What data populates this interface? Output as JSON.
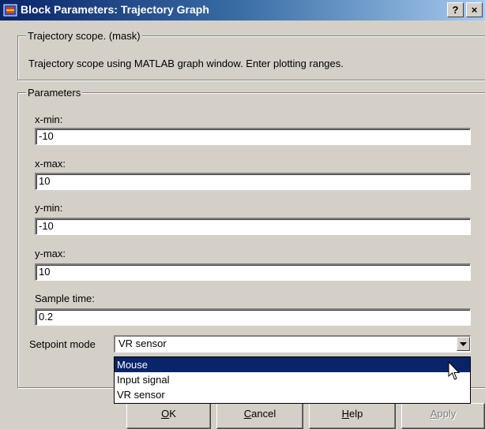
{
  "window": {
    "title": "Block Parameters: Trajectory Graph",
    "help_button": "?",
    "close_button": "×"
  },
  "mask_group": {
    "legend": "Trajectory scope. (mask)",
    "description": "Trajectory scope using MATLAB graph window. Enter plotting ranges."
  },
  "params_group": {
    "legend": "Parameters",
    "fields": [
      {
        "label": "x-min:",
        "value": "-10"
      },
      {
        "label": "x-max:",
        "value": "10"
      },
      {
        "label": "y-min:",
        "value": "-10"
      },
      {
        "label": "y-max:",
        "value": "10"
      },
      {
        "label": "Sample time:",
        "value": "0.2"
      }
    ],
    "setpoint": {
      "label": "Setpoint mode",
      "selected": "VR sensor",
      "options": [
        "Mouse",
        "Input signal",
        "VR sensor"
      ],
      "highlighted_option": "Mouse"
    }
  },
  "buttons": {
    "ok": {
      "mnemonic": "O",
      "rest": "K"
    },
    "cancel": {
      "mnemonic": "C",
      "rest": "ancel"
    },
    "help": {
      "mnemonic": "H",
      "rest": "elp"
    },
    "apply": {
      "mnemonic": "A",
      "rest": "pply"
    }
  },
  "colors": {
    "titlebar_start": "#0a246a",
    "titlebar_end": "#a6caf0",
    "dialog_bg": "#d4d0c8",
    "selection": "#0a246a"
  }
}
